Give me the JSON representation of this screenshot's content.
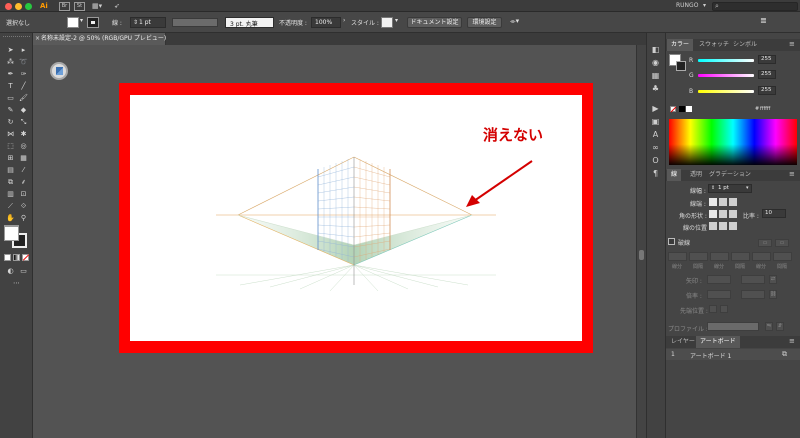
{
  "menubar": {
    "app_icon": "Ai",
    "br_icon": "Br",
    "st_icon": "St",
    "layout_icon": "grid-layout-icon",
    "send_icon": "paper-plane-icon",
    "workspace": "RUNGO",
    "search_placeholder": "",
    "traffic_colors": [
      "#ff5f57",
      "#febc2e",
      "#28c840"
    ]
  },
  "controlbar": {
    "selection_status": "選択なし",
    "stroke_label": "線 :",
    "stroke_weight": "1 pt",
    "brush_label": "3 pt. 丸筆",
    "opacity_label": "不透明度 :",
    "opacity_value": "100%",
    "style_label": "スタイル :",
    "doc_settings_button": "ドキュメント設定",
    "preferences_button": "環境設定"
  },
  "document": {
    "tab_label": "名称未設定-2 @ 50% (RGB/GPU プレビュー)"
  },
  "canvas": {
    "annotation_text": "消えない",
    "annotation_color": "#d40000",
    "frame_color": "#ff0000"
  },
  "color_panel": {
    "tabs": [
      "カラー",
      "スウォッチ",
      "シンボル"
    ],
    "r_label": "R",
    "g_label": "G",
    "b_label": "B",
    "r_value": "255",
    "g_value": "255",
    "b_value": "255",
    "hex_value": "ffffff"
  },
  "stroke_panel": {
    "tabs": [
      "線",
      "透明",
      "グラデーション"
    ],
    "weight_label": "線幅 :",
    "weight_value": "1 pt",
    "cap_label": "線端 :",
    "corner_label": "角の形状 :",
    "limit_label": "比率 :",
    "limit_value": "10",
    "align_label": "線の位置 :",
    "dashed_label": "破線",
    "dash_labels": [
      "線分",
      "間隔",
      "線分",
      "間隔",
      "線分",
      "間隔"
    ],
    "arrow_label": "矢印 :",
    "scale_label": "倍率 :",
    "tip_label": "先端位置 :",
    "profile_label": "プロファイル :"
  },
  "layers_panel": {
    "tabs": [
      "レイヤー",
      "アートボード"
    ],
    "rows": [
      {
        "index": "1",
        "name": "アートボード 1"
      }
    ]
  }
}
